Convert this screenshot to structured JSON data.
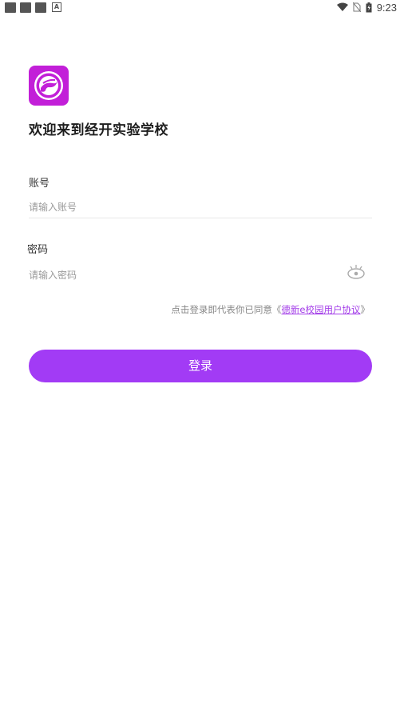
{
  "status_bar": {
    "time": "9:23",
    "notif_a": "A"
  },
  "app": {
    "title": "欢迎来到经开实验学校"
  },
  "account": {
    "label": "账号",
    "placeholder": "请输入账号",
    "value": ""
  },
  "password": {
    "label": "密码",
    "placeholder": "请输入密码",
    "value": ""
  },
  "agreement": {
    "prefix": "点击登录即代表你已同意",
    "open_quote": "《",
    "link": "德新e校园用户协议",
    "close_quote": "》"
  },
  "login": {
    "label": "登录"
  },
  "colors": {
    "accent": "#a23bf5",
    "logo_bg": "#c21fd8"
  }
}
